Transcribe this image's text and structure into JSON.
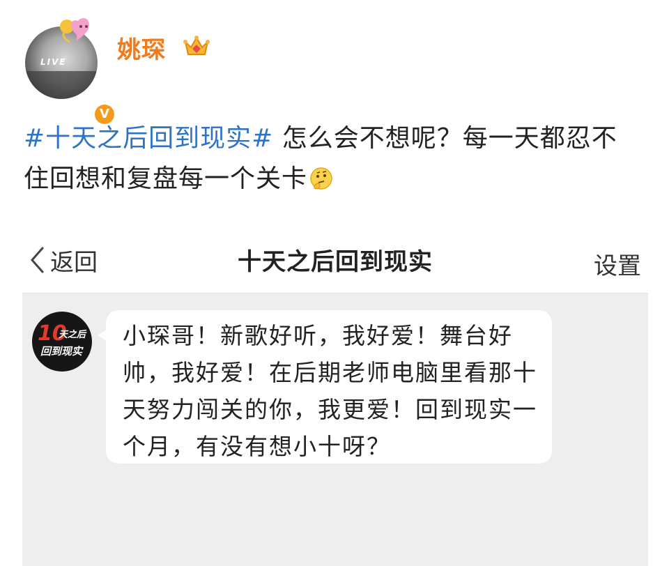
{
  "post": {
    "author": "姚琛",
    "hashtag": "#十天之后回到现实#",
    "text": " 怎么会不想呢？每一天都忍不住回想和复盘每一个关卡",
    "emoji": "thinking-face-emoji"
  },
  "screenshot": {
    "nav": {
      "back_label": "返回",
      "title": "十天之后回到现实",
      "settings_label": "设置"
    },
    "message": {
      "sender_avatar_text": {
        "number": "10",
        "line1": "天之后",
        "line2": "回到现实"
      },
      "text": "小琛哥！新歌好听，我好爱！舞台好帅，我好爱！在后期老师电脑里看那十天努力闯关的你，我更爱！回到现实一个月，有没有想小十呀？"
    }
  },
  "colors": {
    "username": "#f07a1c",
    "hashtag": "#2f73c6",
    "verified": "#f39b1a",
    "chat_bg": "#eeeeee"
  }
}
